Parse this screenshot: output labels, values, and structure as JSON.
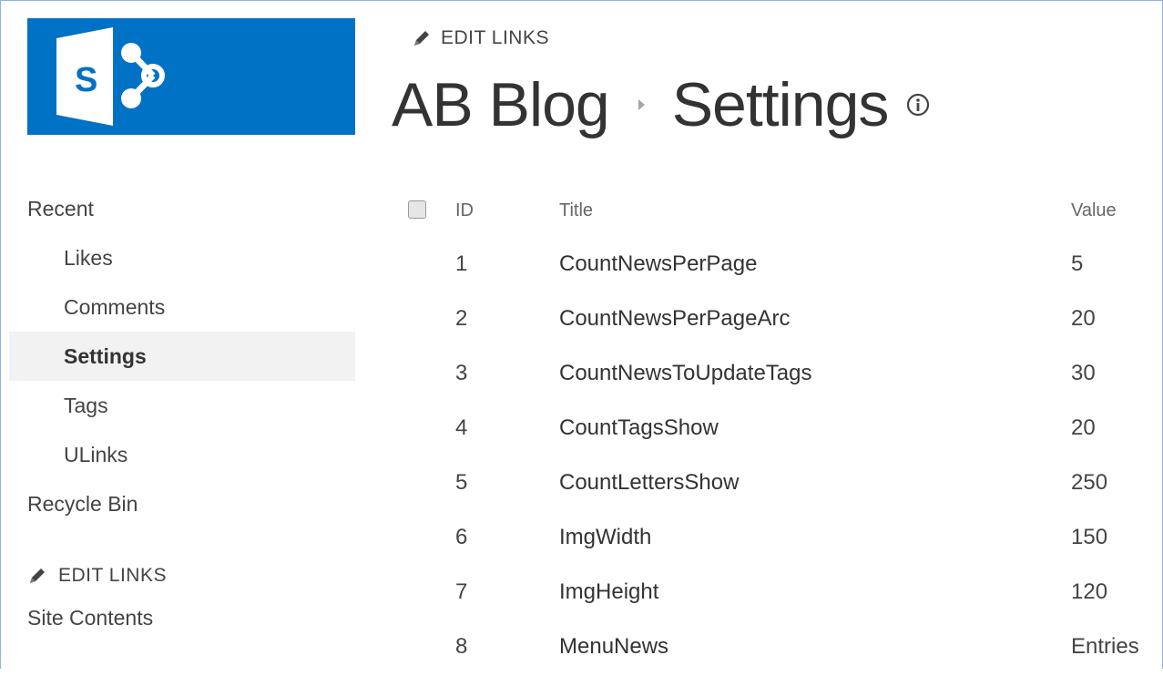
{
  "header": {
    "edit_links": "EDIT LINKS",
    "site_title": "AB Blog",
    "page_title": "Settings"
  },
  "logo": {
    "letter": "S",
    "background": "#0072c6"
  },
  "nav": {
    "items": [
      {
        "label": "Recent",
        "level": 0,
        "selected": false
      },
      {
        "label": "Likes",
        "level": 1,
        "selected": false
      },
      {
        "label": "Comments",
        "level": 1,
        "selected": false
      },
      {
        "label": "Settings",
        "level": 1,
        "selected": true
      },
      {
        "label": "Tags",
        "level": 1,
        "selected": false
      },
      {
        "label": "ULinks",
        "level": 1,
        "selected": false
      },
      {
        "label": "Recycle Bin",
        "level": 0,
        "selected": false
      }
    ],
    "edit_links": "EDIT LINKS",
    "site_contents": "Site Contents"
  },
  "list": {
    "columns": {
      "id": "ID",
      "title": "Title",
      "value": "Value"
    },
    "rows": [
      {
        "id": "1",
        "title": "CountNewsPerPage",
        "value": "5"
      },
      {
        "id": "2",
        "title": "CountNewsPerPageArc",
        "value": "20"
      },
      {
        "id": "3",
        "title": "CountNewsToUpdateTags",
        "value": "30"
      },
      {
        "id": "4",
        "title": "CountTagsShow",
        "value": "20"
      },
      {
        "id": "5",
        "title": "CountLettersShow",
        "value": "250"
      },
      {
        "id": "6",
        "title": "ImgWidth",
        "value": "150"
      },
      {
        "id": "7",
        "title": "ImgHeight",
        "value": "120"
      },
      {
        "id": "8",
        "title": "MenuNews",
        "value": "Entries"
      }
    ]
  },
  "icons": {
    "pencil": "pencil-icon",
    "info": "info-icon",
    "breadcrumb_separator": "chevron-right-icon",
    "select_all": "checkbox-icon"
  }
}
